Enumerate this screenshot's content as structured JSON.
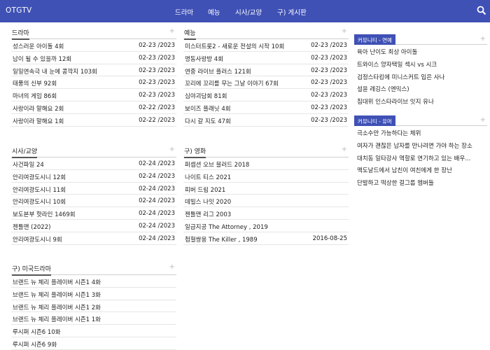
{
  "header": {
    "logo": "OTGTV",
    "nav": [
      "드라마",
      "예능",
      "시사/교양",
      "구) 게시판"
    ],
    "search_icon": "search-icon"
  },
  "panels": [
    {
      "title": "드라마",
      "more": "+",
      "items": [
        {
          "title": "성스러운 아이돌 4회",
          "date": "02-23 /2023"
        },
        {
          "title": "남이 될 수 있을까 12회",
          "date": "02-23 /2023"
        },
        {
          "title": "일일연속극 내 눈에 콩깍지 103회",
          "date": "02-23 /2023"
        },
        {
          "title": "태풍의 신부 92회",
          "date": "02-23 /2023"
        },
        {
          "title": "마녀의 게임 86회",
          "date": "02-23 /2023"
        },
        {
          "title": "사랑이라 말해요 2회",
          "date": "02-22 /2023"
        },
        {
          "title": "사랑이라 말해요 1회",
          "date": "02-22 /2023"
        }
      ]
    },
    {
      "title": "예능",
      "more": "+",
      "items": [
        {
          "title": "미스터트롯2 - 새로운 전설의 시작 10회",
          "date": "02-23 /2023"
        },
        {
          "title": "명동사랑방 4회",
          "date": "02-23 /2023"
        },
        {
          "title": "연중 라이브 플러스 121회",
          "date": "02-23 /2023"
        },
        {
          "title": "꼬리에 꼬리를 무는 그날 이야기 67회",
          "date": "02-23 /2023"
        },
        {
          "title": "심야괴담회 81회",
          "date": "02-23 /2023"
        },
        {
          "title": "보이즈 플래닛 4회",
          "date": "02-23 /2023"
        },
        {
          "title": "다시 갈 지도 47회",
          "date": "02-23 /2023"
        }
      ]
    },
    {
      "title": "시사/교양",
      "more": "+",
      "items": [
        {
          "title": "사건파일 24",
          "date": "02-24 /2023"
        },
        {
          "title": "안리여광도시니 12회",
          "date": "02-24 /2023"
        },
        {
          "title": "안리여광도시니 11회",
          "date": "02-24 /2023"
        },
        {
          "title": "안리여광도시니 10회",
          "date": "02-24 /2023"
        },
        {
          "title": "보도본부 핫라인 1469회",
          "date": "02-24 /2023"
        },
        {
          "title": "젠틀맨 (2022)",
          "date": "02-24 /2023"
        },
        {
          "title": "안리여광도시니 9회",
          "date": "02-24 /2023"
        }
      ]
    },
    {
      "title": "구) 영화",
      "more": "+",
      "items": [
        {
          "title": "퍼셉션 오브 블러드 2018",
          "date": ""
        },
        {
          "title": "나이트 티스 2021",
          "date": ""
        },
        {
          "title": "피버 드림 2021",
          "date": ""
        },
        {
          "title": "데빌스 나잇 2020",
          "date": ""
        },
        {
          "title": "젠틀맨 리그 2003",
          "date": ""
        },
        {
          "title": "일급지공 The Attorney , 2019",
          "date": ""
        },
        {
          "title": "첩혈쌍웅 The Killer , 1989",
          "date": "2016-08-25"
        }
      ]
    },
    {
      "title": "구) 미국드라마",
      "more": "+",
      "items": [
        {
          "title": "브랜드 뉴 체리 플레이버 시즌1 4화",
          "date": ""
        },
        {
          "title": "브랜드 뉴 체리 플레이버 시즌1 3화",
          "date": ""
        },
        {
          "title": "브랜드 뉴 체리 플레이버 시즌1 2화",
          "date": ""
        },
        {
          "title": "브랜드 뉴 체리 플레이버 시즌1 1화",
          "date": ""
        },
        {
          "title": "루시퍼 시즌6 10화",
          "date": ""
        },
        {
          "title": "루시퍼 시즌6 9화",
          "date": ""
        }
      ]
    }
  ],
  "side": [
    {
      "title": "커뮤니티 - 연예",
      "more": "+",
      "items": [
        "육아 난이도 최상 아이돌",
        "트와이스 양자택일 섹시 vs 시크",
        "검정스타킹에 미니스커트 입은 사나",
        "설윤 레깅스 (엔믹스)",
        "침대위 인스타라이브 잇지 유나"
      ]
    },
    {
      "title": "커뮤니티 - 유머",
      "more": "+",
      "items": [
        "극소수만 가능하다는 체위",
        "여자가 괜찮은 남자를 만나려면 가야 하는 장소",
        "대치동 일타강사 역할로 연기하고 있는 배우...",
        "맥도날드에서 남친이 여친에게 한 장난",
        "단발하고 떡상한 걸그룹 멤버들"
      ]
    }
  ],
  "colors": {
    "accent": "#3f51b5"
  }
}
